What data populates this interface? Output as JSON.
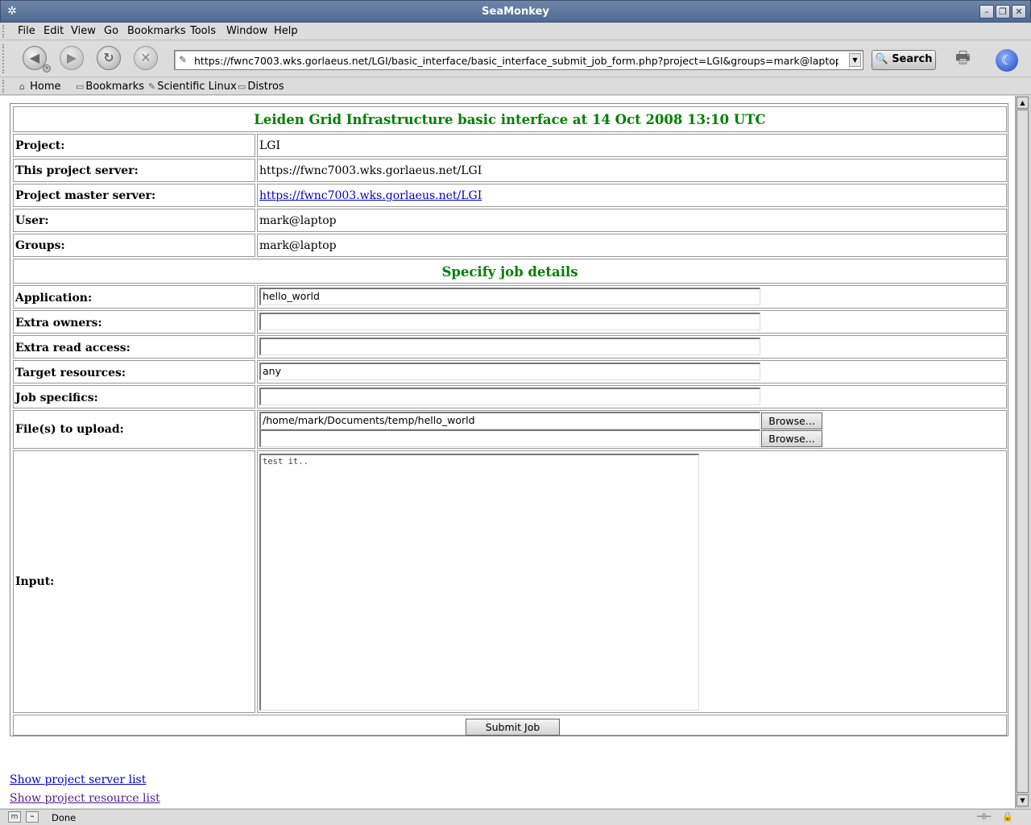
{
  "window": {
    "title": "SeaMonkey",
    "app_icon": "seamonkey-icon"
  },
  "menu": [
    "File",
    "Edit",
    "View",
    "Go",
    "Bookmarks",
    "Tools",
    "Window",
    "Help"
  ],
  "nav": {
    "url": "https://fwnc7003.wks.gorlaeus.net/LGI/basic_interface/basic_interface_submit_job_form.php?project=LGI&groups=mark@laptop&sid=",
    "search_label": "Search"
  },
  "personal_toolbar": [
    "Home",
    "Bookmarks",
    "Scientific Linux",
    "Distros"
  ],
  "page": {
    "title": "Leiden Grid Infrastructure basic interface at 14 Oct 2008 13:10 UTC",
    "info": [
      {
        "label": "Project:",
        "value": "LGI"
      },
      {
        "label": "This project server:",
        "value": "https://fwnc7003.wks.gorlaeus.net/LGI"
      },
      {
        "label": "Project master server:",
        "value": "https://fwnc7003.wks.gorlaeus.net/LGI"
      },
      {
        "label": "User:",
        "value": "mark@laptop"
      },
      {
        "label": "Groups:",
        "value": "mark@laptop"
      }
    ],
    "section_title": "Specify job details",
    "form": {
      "application": {
        "label": "Application:",
        "value": "hello_world"
      },
      "extra_owners": {
        "label": "Extra owners:",
        "value": ""
      },
      "extra_read": {
        "label": "Extra read access:",
        "value": ""
      },
      "target": {
        "label": "Target resources:",
        "value": "any"
      },
      "specifics": {
        "label": "Job specifics:",
        "value": ""
      },
      "files": {
        "label": "File(s) to upload:",
        "file1": "/home/mark/Documents/temp/hello_world",
        "file2": "",
        "browse_label": "Browse..."
      },
      "input": {
        "label": "Input:",
        "value": "test it.."
      },
      "submit_label": "Submit Job"
    },
    "links": [
      "Show project server list",
      "Show project resource list"
    ]
  },
  "status": {
    "text": "Done"
  }
}
